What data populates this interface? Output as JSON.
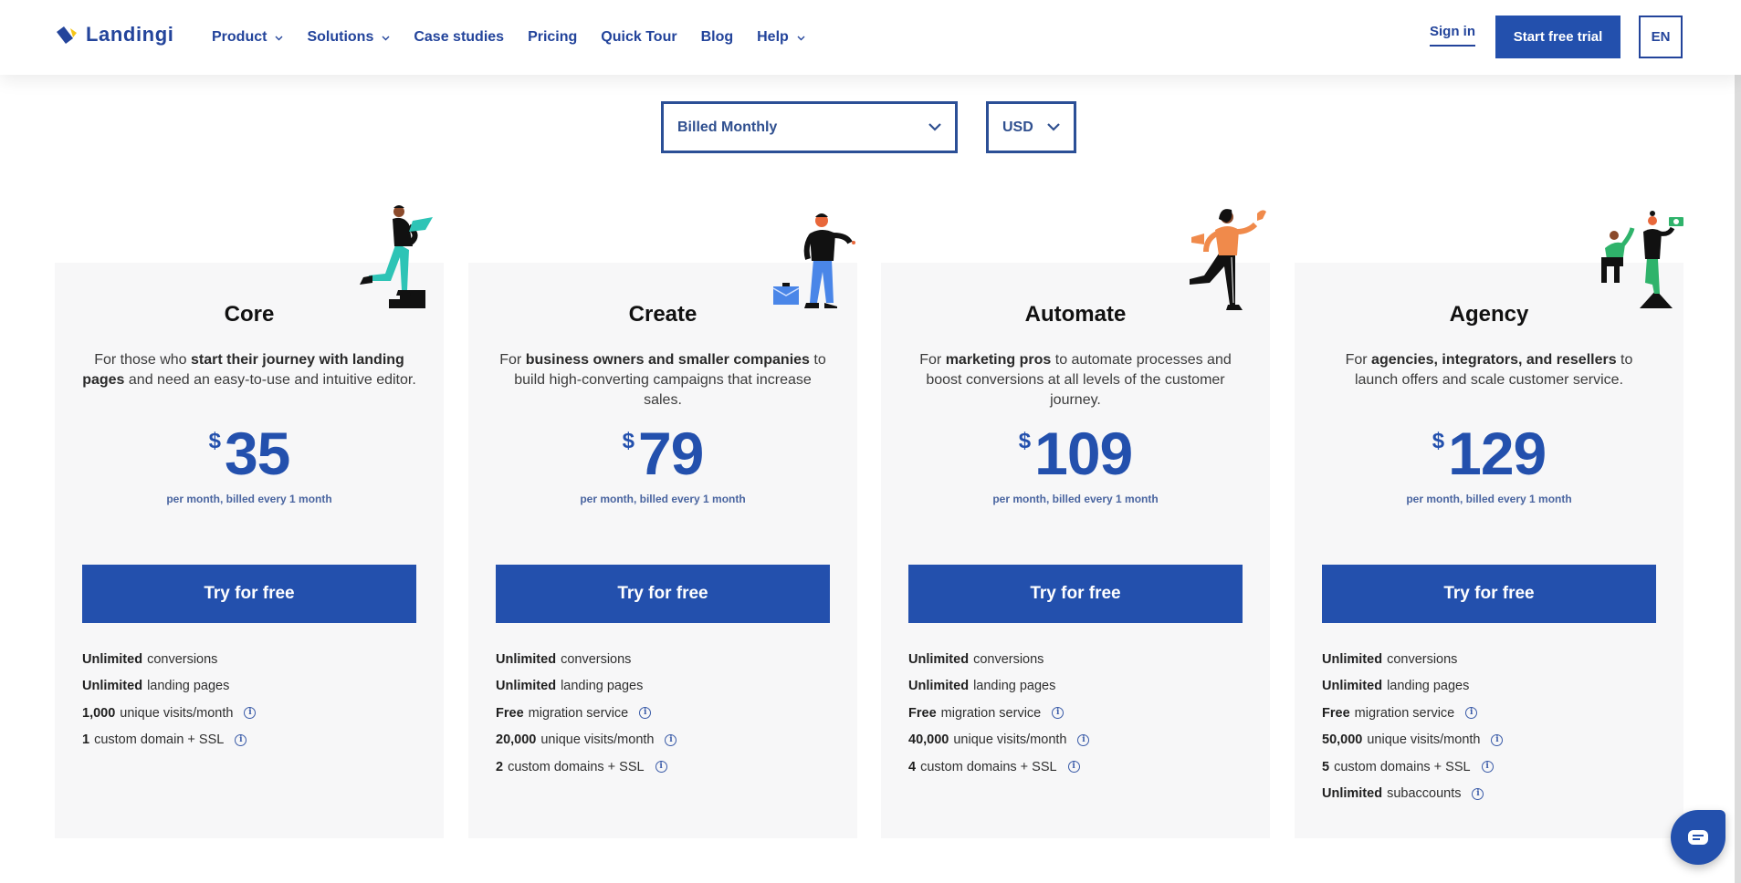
{
  "header": {
    "logo_text": "Landingi",
    "nav": [
      {
        "label": "Product",
        "has_dropdown": true
      },
      {
        "label": "Solutions",
        "has_dropdown": true
      },
      {
        "label": "Case studies",
        "has_dropdown": false
      },
      {
        "label": "Pricing",
        "has_dropdown": false
      },
      {
        "label": "Quick Tour",
        "has_dropdown": false
      },
      {
        "label": "Blog",
        "has_dropdown": false
      },
      {
        "label": "Help",
        "has_dropdown": true
      }
    ],
    "sign_in": "Sign in",
    "start_trial": "Start free trial",
    "language": "EN"
  },
  "selectors": {
    "billing": "Billed Monthly",
    "currency": "USD"
  },
  "colors": {
    "brand_blue": "#2350ad",
    "text_blue": "#23449b",
    "logo_yellow": "#f5c518",
    "card_bg": "#f7f7f8"
  },
  "plans": [
    {
      "name": "Core",
      "illustration": "person-climbing-stairs-with-laptop",
      "description": [
        {
          "t": "For those who ",
          "b": false
        },
        {
          "t": "start their journey with landing pages",
          "b": true
        },
        {
          "t": " and need an easy-to-use and intuitive editor.",
          "b": false
        }
      ],
      "currency_symbol": "$",
      "price": "35",
      "period": "per month, billed every 1 month",
      "cta": "Try for free",
      "features": [
        {
          "bold": "Unlimited",
          "text": "conversions",
          "info": false
        },
        {
          "bold": "Unlimited",
          "text": "landing pages",
          "info": false
        },
        {
          "bold": "1,000",
          "text": "unique visits/month",
          "info": true
        },
        {
          "bold": "1",
          "text": "custom domain + SSL",
          "info": true
        }
      ]
    },
    {
      "name": "Create",
      "illustration": "person-with-briefcase",
      "description": [
        {
          "t": "For ",
          "b": false
        },
        {
          "t": "business owners and smaller companies",
          "b": true
        },
        {
          "t": " to build high-converting campaigns that increase sales.",
          "b": false
        }
      ],
      "currency_symbol": "$",
      "price": "79",
      "period": "per month, billed every 1 month",
      "cta": "Try for free",
      "features": [
        {
          "bold": "Unlimited",
          "text": "conversions",
          "info": false
        },
        {
          "bold": "Unlimited",
          "text": "landing pages",
          "info": false
        },
        {
          "bold": "Free",
          "text": "migration service",
          "info": true
        },
        {
          "bold": "20,000",
          "text": "unique visits/month",
          "info": true
        },
        {
          "bold": "2",
          "text": "custom domains + SSL",
          "info": true
        }
      ]
    },
    {
      "name": "Automate",
      "illustration": "person-with-megaphone-and-bird",
      "description": [
        {
          "t": "For ",
          "b": false
        },
        {
          "t": "marketing pros",
          "b": true
        },
        {
          "t": " to automate processes and boost conversions at all levels of the customer journey.",
          "b": false
        }
      ],
      "currency_symbol": "$",
      "price": "109",
      "period": "per month, billed every 1 month",
      "cta": "Try for free",
      "features": [
        {
          "bold": "Unlimited",
          "text": "conversions",
          "info": false
        },
        {
          "bold": "Unlimited",
          "text": "landing pages",
          "info": false
        },
        {
          "bold": "Free",
          "text": "migration service",
          "info": true
        },
        {
          "bold": "40,000",
          "text": "unique visits/month",
          "info": true
        },
        {
          "bold": "4",
          "text": "custom domains + SSL",
          "info": true
        }
      ]
    },
    {
      "name": "Agency",
      "illustration": "two-people-with-camera",
      "description": [
        {
          "t": "For ",
          "b": false
        },
        {
          "t": "agencies, integrators, and resellers",
          "b": true
        },
        {
          "t": " to launch offers and scale customer service.",
          "b": false
        }
      ],
      "currency_symbol": "$",
      "price": "129",
      "period": "per month, billed every 1 month",
      "cta": "Try for free",
      "features": [
        {
          "bold": "Unlimited",
          "text": "conversions",
          "info": false
        },
        {
          "bold": "Unlimited",
          "text": "landing pages",
          "info": false
        },
        {
          "bold": "Free",
          "text": "migration service",
          "info": true
        },
        {
          "bold": "50,000",
          "text": "unique visits/month",
          "info": true
        },
        {
          "bold": "5",
          "text": "custom domains + SSL",
          "info": true
        },
        {
          "bold": "Unlimited",
          "text": "subaccounts",
          "info": true
        }
      ]
    }
  ],
  "chat": {
    "icon": "chat-bubble-icon"
  }
}
